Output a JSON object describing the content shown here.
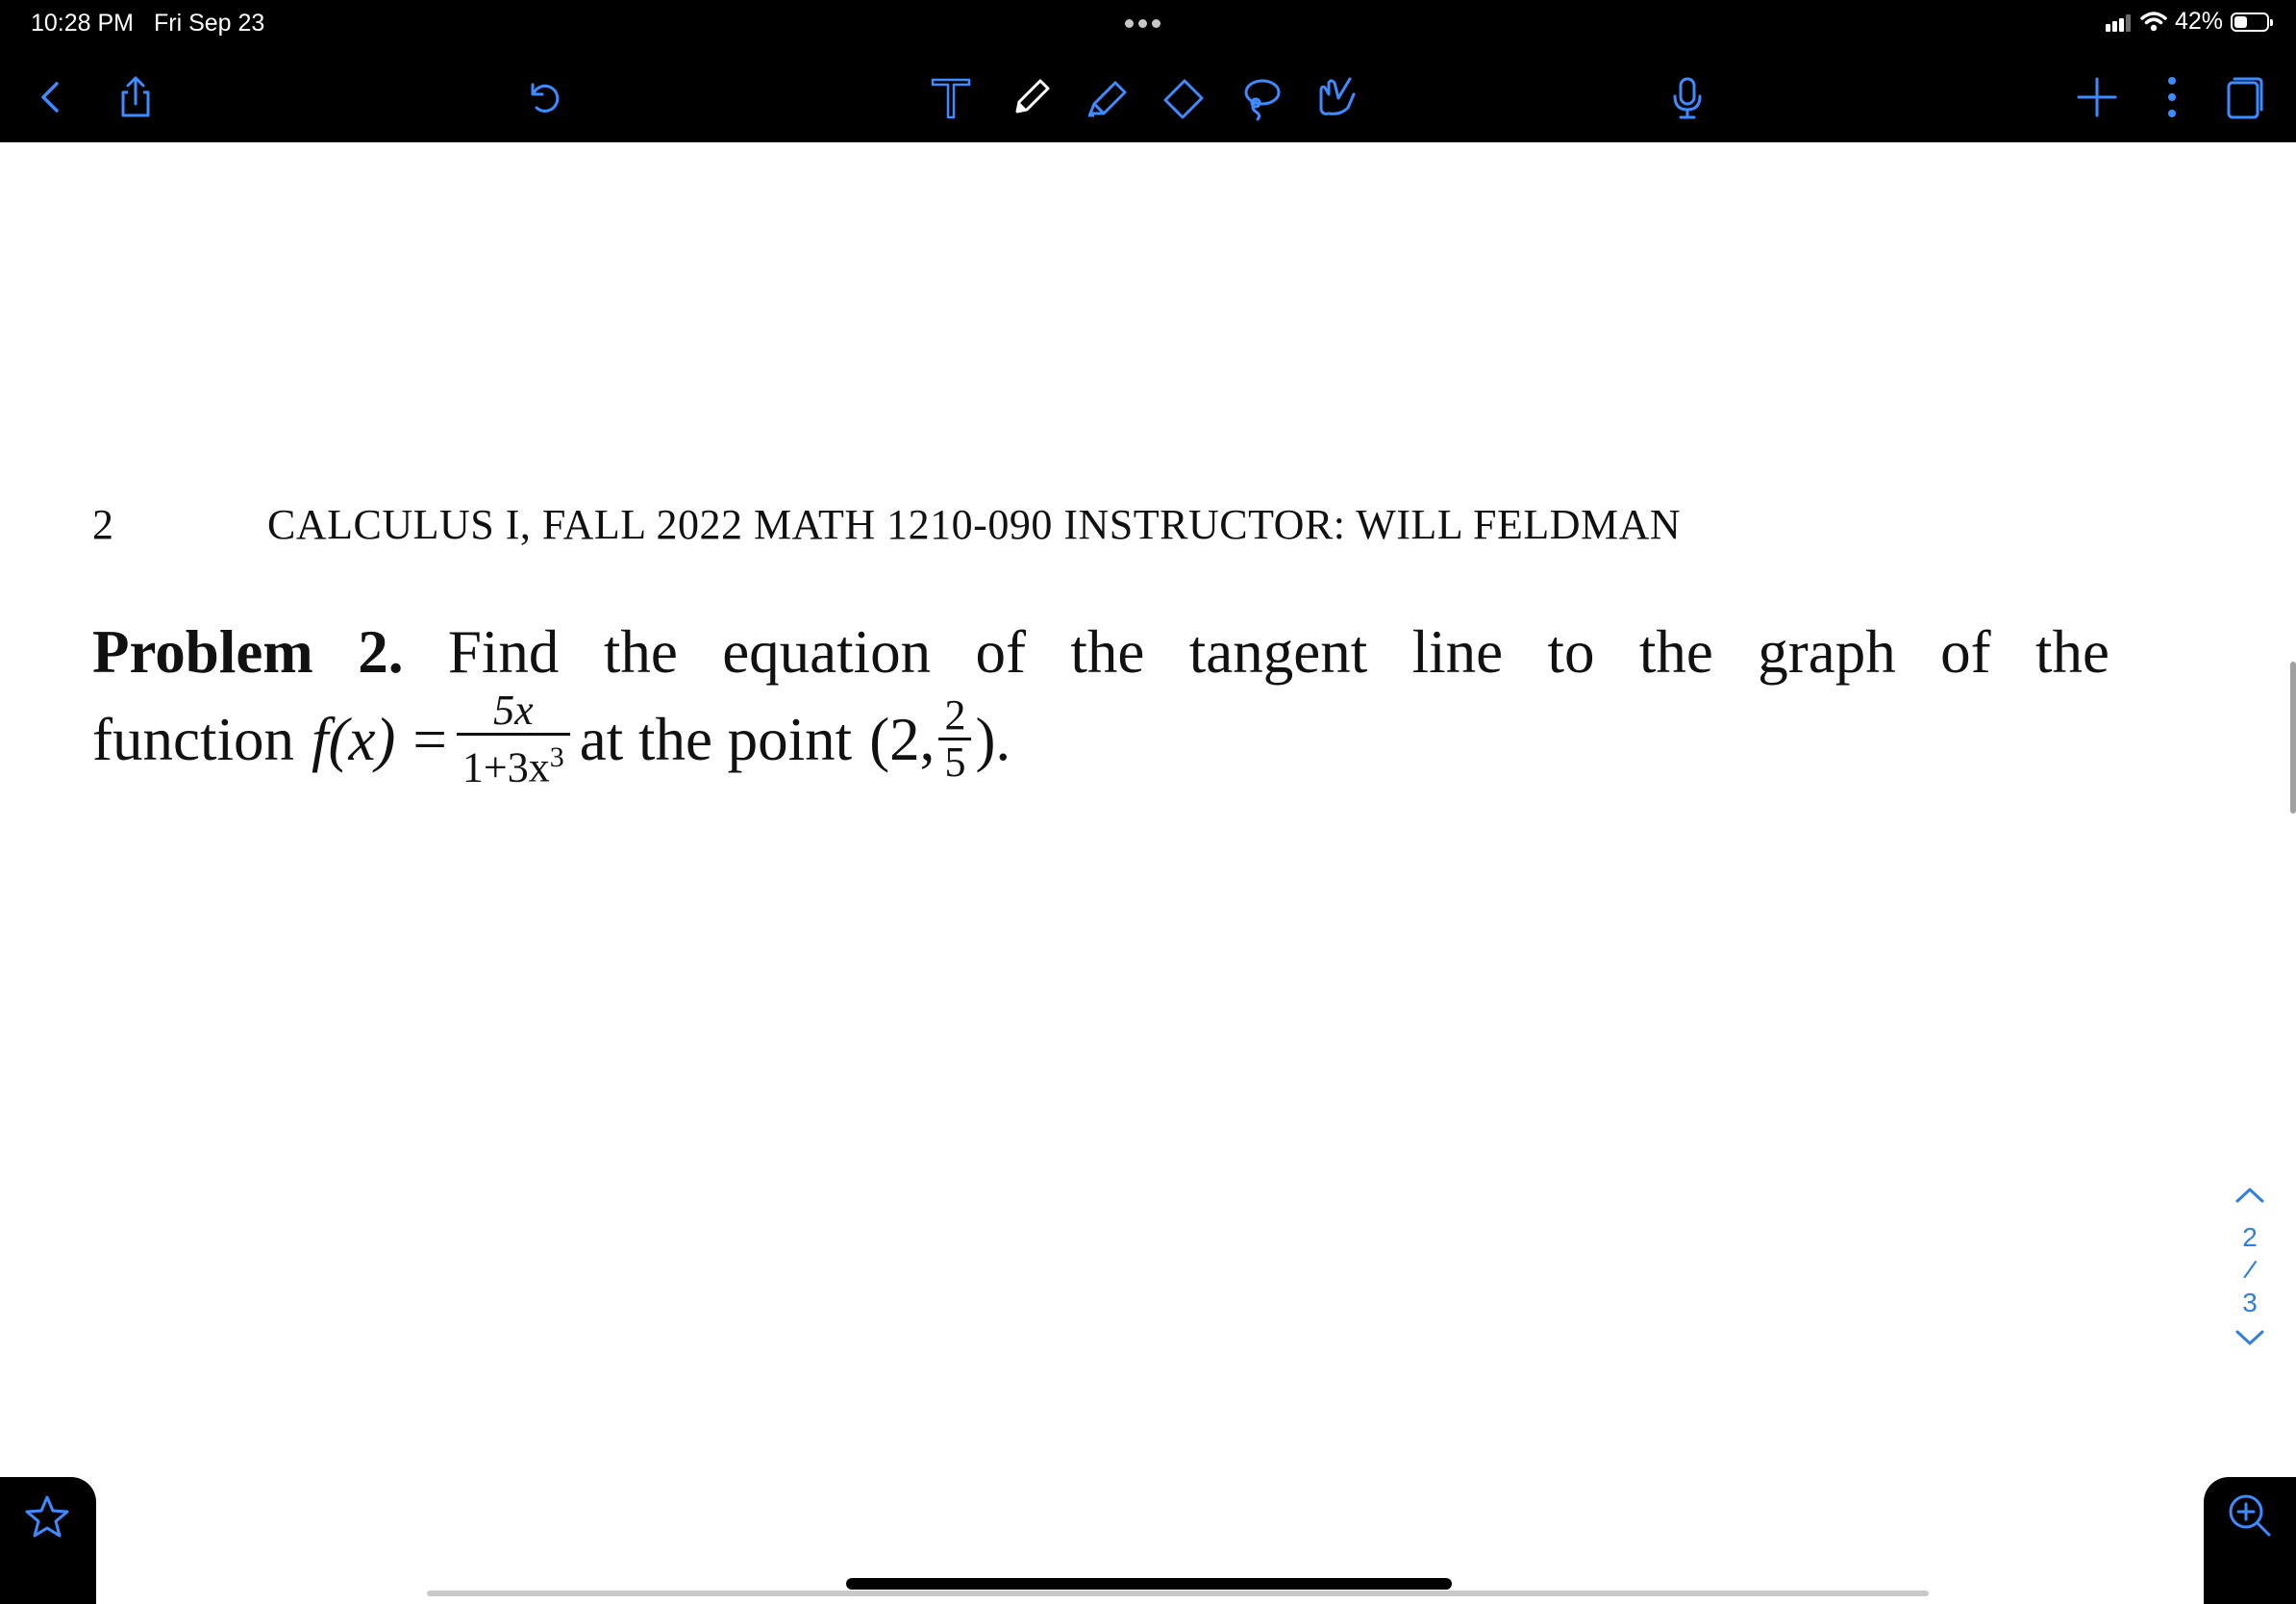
{
  "status_bar": {
    "time": "10:28 PM",
    "date": "Fri Sep 23",
    "battery": "42%",
    "battery_level": 0.42
  },
  "toolbar": {
    "icons": [
      "back-chevron-icon",
      "share-icon",
      "undo-icon",
      "text-tool-icon",
      "pen-icon",
      "highlighter-icon",
      "eraser-icon",
      "lasso-icon",
      "hand-drawing-icon",
      "microphone-icon",
      "add-icon",
      "more-icon",
      "pages-icon"
    ],
    "accent": "#3d8bff"
  },
  "document": {
    "page_number": "2",
    "running_header": "CALCULUS I, FALL 2022 MATH 1210-090 INSTRUCTOR: WILL FELDMAN",
    "problem": {
      "label": "Problem 2.",
      "line1": "Find the equation of the tangent line to the graph of the",
      "line2_start": "function",
      "func": "f",
      "var": "(x)",
      "equals": "=",
      "frac_num": "5x",
      "frac_den_base": "1+3x",
      "frac_den_exp": "3",
      "mid_text": "at the point",
      "point_open": "(2,",
      "point_num": "2",
      "point_den": "5",
      "point_close": ")."
    }
  },
  "pager": {
    "current": "2",
    "separator": "/",
    "total": "3"
  }
}
